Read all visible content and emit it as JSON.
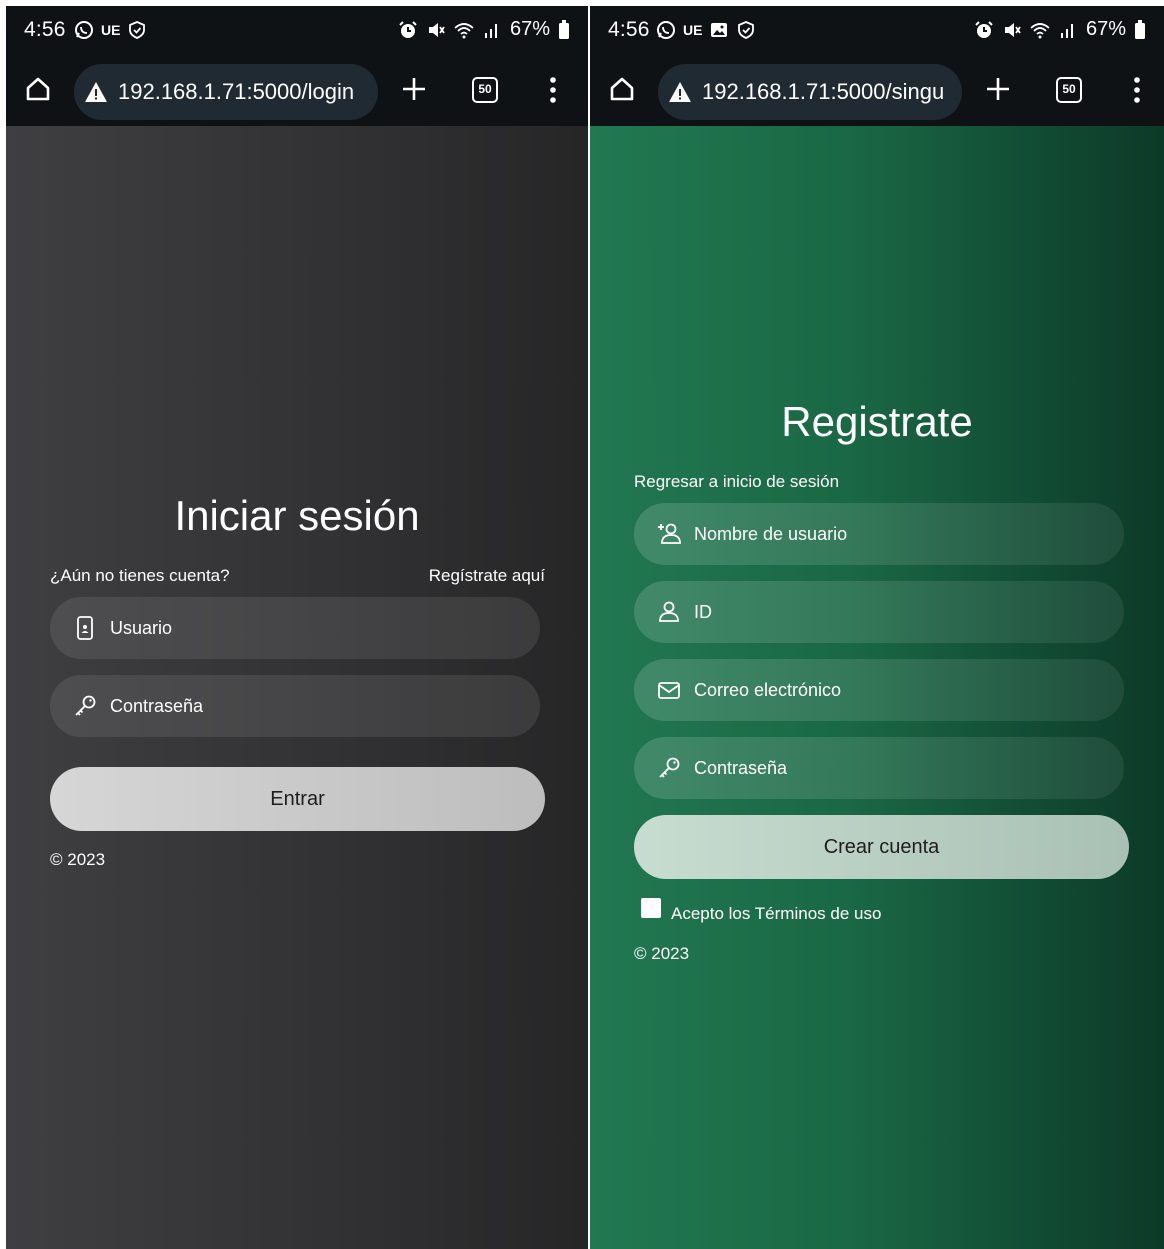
{
  "left_screen": {
    "status": {
      "time": "4:56",
      "carrier": "UE",
      "battery": "67%"
    },
    "browser": {
      "url": "192.168.1.71:5000/login",
      "tab_count": "50"
    },
    "page": {
      "title": "Iniciar sesión",
      "no_account_text": "¿Aún no tienes cuenta?",
      "register_link": "Regístrate aquí",
      "username_placeholder": "Usuario",
      "password_placeholder": "Contraseña",
      "submit_label": "Entrar",
      "footer": "© 2023"
    }
  },
  "right_screen": {
    "status": {
      "time": "4:56",
      "carrier": "UE",
      "battery": "67%"
    },
    "browser": {
      "url": "192.168.1.71:5000/singu",
      "tab_count": "50"
    },
    "page": {
      "title": "Registrate",
      "back_link": "Regresar a inicio de sesión",
      "username_placeholder": "Nombre de usuario",
      "id_placeholder": "ID",
      "email_placeholder": "Correo electrónico",
      "password_placeholder": "Contraseña",
      "submit_label": "Crear cuenta",
      "terms_label": "Acepto los Términos de uso",
      "terms_checked": false,
      "footer": "© 2023"
    }
  },
  "icons": [
    "whatsapp-icon",
    "shield-check-icon",
    "image-icon",
    "alarm-icon",
    "mute-icon",
    "wifi-icon",
    "signal-icon",
    "battery-icon",
    "home-icon",
    "warning-icon",
    "plus-icon",
    "tabs-icon",
    "more-vert-icon",
    "phone-user-icon",
    "key-icon",
    "add-user-icon",
    "user-icon",
    "mail-icon"
  ],
  "colors": {
    "login_bg": "#353537",
    "signup_bg": "#1a6845",
    "chrome_bg": "#0f1214",
    "url_pill": "#1f2a33"
  }
}
